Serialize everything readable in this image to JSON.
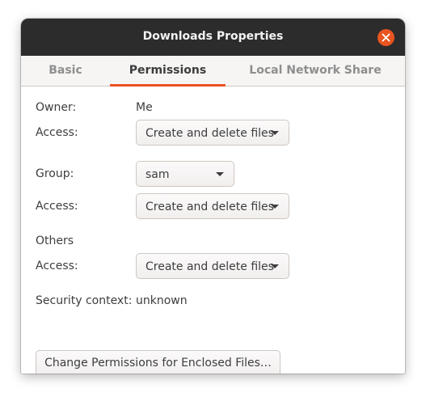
{
  "window": {
    "title": "Downloads Properties",
    "close_icon": "close-icon"
  },
  "tabs": [
    {
      "label": "Basic",
      "active": false
    },
    {
      "label": "Permissions",
      "active": true
    },
    {
      "label": "Local Network Share",
      "active": false
    }
  ],
  "permissions": {
    "owner": {
      "label": "Owner:",
      "value": "Me"
    },
    "owner_access": {
      "label": "Access:",
      "value": "Create and delete files"
    },
    "group": {
      "label": "Group:",
      "value": "sam"
    },
    "group_access": {
      "label": "Access:",
      "value": "Create and delete files"
    },
    "others": {
      "label": "Others"
    },
    "others_access": {
      "label": "Access:",
      "value": "Create and delete files"
    },
    "security": {
      "label": "Security context:",
      "value": "unknown"
    },
    "change_button": "Change Permissions for Enclosed Files…"
  },
  "colors": {
    "titlebar": "#2c2c2c",
    "accent": "#e95420",
    "text": "#3d3d3d",
    "inactive_tab": "#8e8e8e"
  }
}
